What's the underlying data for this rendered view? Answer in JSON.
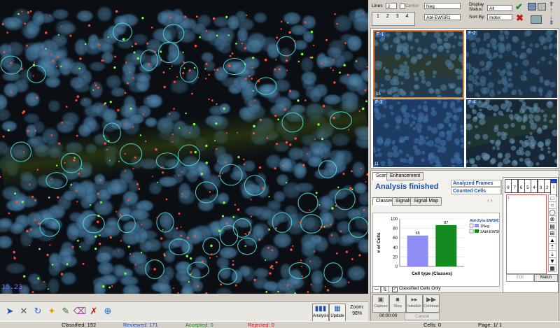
{
  "image": {
    "frame_label": "15.23"
  },
  "toolbar": {
    "lines_label": "Lines",
    "lines_value": "2",
    "center_label": "Center",
    "probe_c1": "Neg",
    "probe_c2": "Abl-EWSR1",
    "display_status_label": "Display Status:",
    "display_status_value": "All",
    "sort_by_label": "Sort By:",
    "sort_by_value": "Index"
  },
  "thumbnails": [
    {
      "label": "F-1",
      "count": "15"
    },
    {
      "label": "F-2",
      "count": ""
    },
    {
      "label": "F-3",
      "count": "11"
    },
    {
      "label": "F-4",
      "count": ""
    }
  ],
  "panel": {
    "tabs": [
      "Scan",
      "Enhancement"
    ],
    "status_title": "Analysis finished",
    "analyzed_frames_label": "Analyzed Frames",
    "analyzed_frames_value": "4",
    "counted_cells_label": "Counted Cells",
    "counted_cells_value": "203",
    "subtabs": [
      "Classes",
      "Signals",
      "Signal Map"
    ],
    "classified_only_label": "Classified Cells Only",
    "buttons": [
      "Capture",
      "Stop",
      "Initialize",
      "Continue"
    ],
    "timer": "00:00:00",
    "cancel_label": "Cancel",
    "edit_label": "Edit",
    "match_label": "Match",
    "class_list_first": "1",
    "class_numbers": [
      "8",
      "7",
      "6",
      "5",
      "4",
      "3",
      "2",
      "1"
    ]
  },
  "bottom": {
    "analysis_label": "Analysis",
    "update_label": "Update",
    "zoom_label": "Zoom:",
    "zoom_value": "98%"
  },
  "status": {
    "classified": "Classified: 152",
    "reviewed": "Reviewed: 171",
    "accepted": "Accepted: 0",
    "rejected": "Rejected: 0",
    "cells": "Cells: 0",
    "page": "Page: 1/ 1"
  },
  "chart_data": {
    "type": "bar",
    "title": "",
    "legend_title": "Abl-Zyto-EWSR1",
    "categories": [
      "1Neg",
      "2Abl-EWSR1"
    ],
    "series": [
      {
        "name": "1Neg",
        "values": [
          65,
          null
        ],
        "color": "#8f8cf4"
      },
      {
        "name": "2Abl-EWSR1",
        "values": [
          null,
          87
        ],
        "color": "#138a1f"
      }
    ],
    "values": [
      65,
      87
    ],
    "xlabel": "Cell type (Classes)",
    "ylabel": "# of Cells",
    "ylim": [
      0,
      100
    ],
    "yticks": [
      0,
      20,
      40,
      60,
      80,
      100
    ],
    "grid": true,
    "legend_position": "right"
  }
}
